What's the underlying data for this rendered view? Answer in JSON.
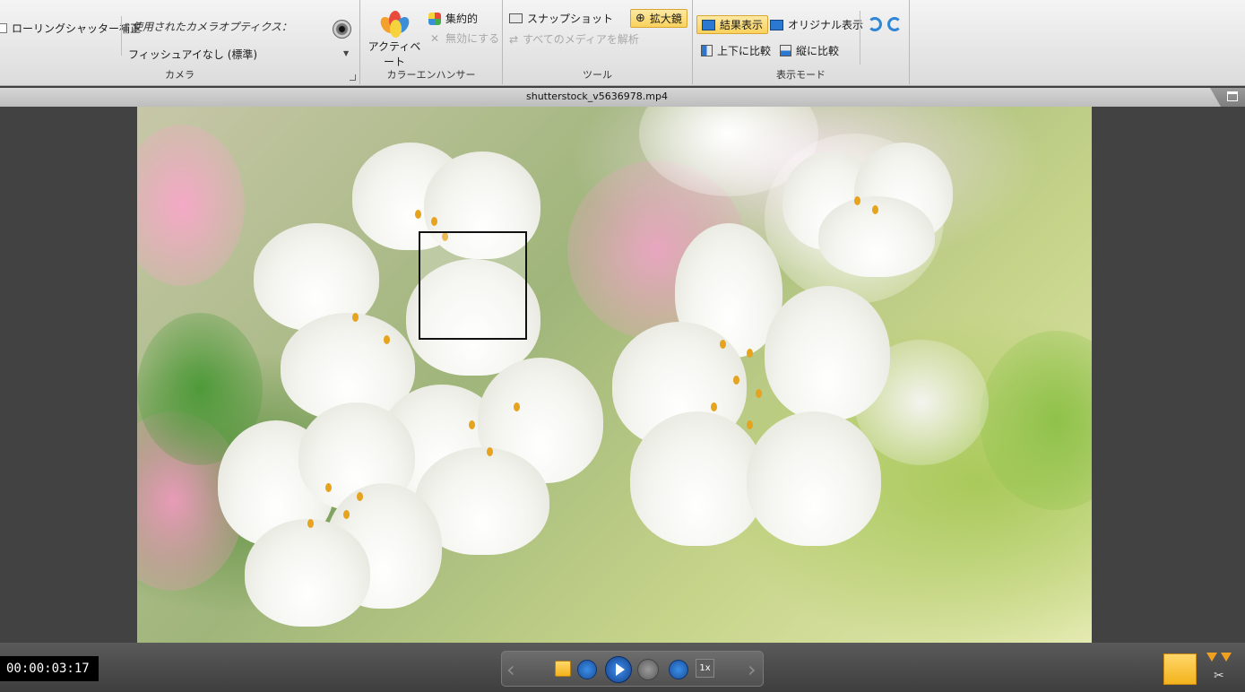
{
  "ribbon": {
    "camera": {
      "rolling_shutter_label": "ローリングシャッター補正",
      "lens_label": "使用されたカメラオプティクス：",
      "lens_value": "フィッシュアイなし (標準)",
      "group_label": "カメラ"
    },
    "color_enhancer": {
      "activate_label": "アクティベート",
      "intensive_label": "集約的",
      "disable_label": "無効にする",
      "group_label": "カラーエンハンサー"
    },
    "tools": {
      "snapshot_label": "スナップショット",
      "magnifier_label": "拡大鏡",
      "analyze_label": "すべてのメディアを解析",
      "group_label": "ツール"
    },
    "display_mode": {
      "result_label": "結果表示",
      "original_label": "オリジナル表示",
      "top_bottom_label": "上下に比較",
      "side_label": "縦に比較",
      "group_label": "表示モード"
    }
  },
  "title": {
    "filename": "shutterstock_v5636978.mp4"
  },
  "player": {
    "timecode": "00:00:03:17",
    "speed_label": "1x"
  },
  "colors": {
    "accent": "#f9d25d",
    "play_blue": "#1e5fb8"
  }
}
